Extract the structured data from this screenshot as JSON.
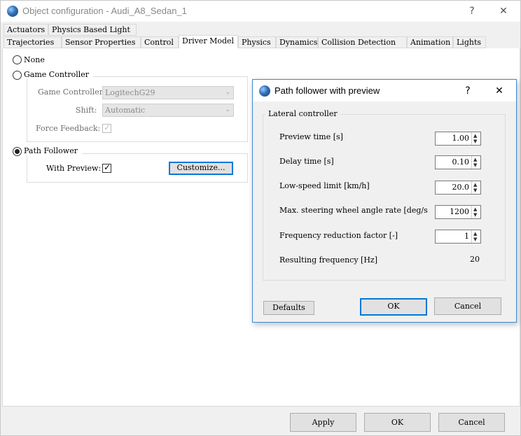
{
  "window": {
    "title": "Object configuration - Audi_A8_Sedan_1",
    "help_glyph": "?",
    "close_glyph": "✕"
  },
  "tabs_row1": [
    "Actuators",
    "Physics Based Light"
  ],
  "tabs_row2": [
    "Trajectories",
    "Sensor Properties",
    "Control",
    "Driver Model",
    "Physics",
    "Dynamics",
    "Collision Detection",
    "Animation",
    "Lights"
  ],
  "active_tab": "Driver Model",
  "driver_model": {
    "none_label": "None",
    "game_controller_label": "Game Controller",
    "game_controller_field_label": "Game Controller",
    "game_controller_value": "LogitechG29",
    "shift_label": "Shift:",
    "shift_value": "Automatic",
    "force_feedback_label": "Force Feedback:",
    "path_follower_label": "Path Follower",
    "with_preview_label": "With Preview:",
    "customize_label": "Customize..."
  },
  "dialog": {
    "title": "Path follower with preview",
    "help_glyph": "?",
    "close_glyph": "✕",
    "group_label": "Lateral controller",
    "rows": [
      {
        "label": "Preview time [s]",
        "value": "1.00"
      },
      {
        "label": "Delay time [s]",
        "value": "0.10"
      },
      {
        "label": "Low-speed limit [km/h]",
        "value": "20.0"
      },
      {
        "label": "Max. steering wheel angle rate [deg/s",
        "value": "1200"
      },
      {
        "label": "Frequency reduction factor [-]",
        "value": "1"
      }
    ],
    "result_label": "Resulting frequency [Hz]",
    "result_value": "20",
    "defaults_label": "Defaults",
    "ok_label": "OK",
    "cancel_label": "Cancel"
  },
  "footer": {
    "apply_label": "Apply",
    "ok_label": "OK",
    "cancel_label": "Cancel"
  }
}
